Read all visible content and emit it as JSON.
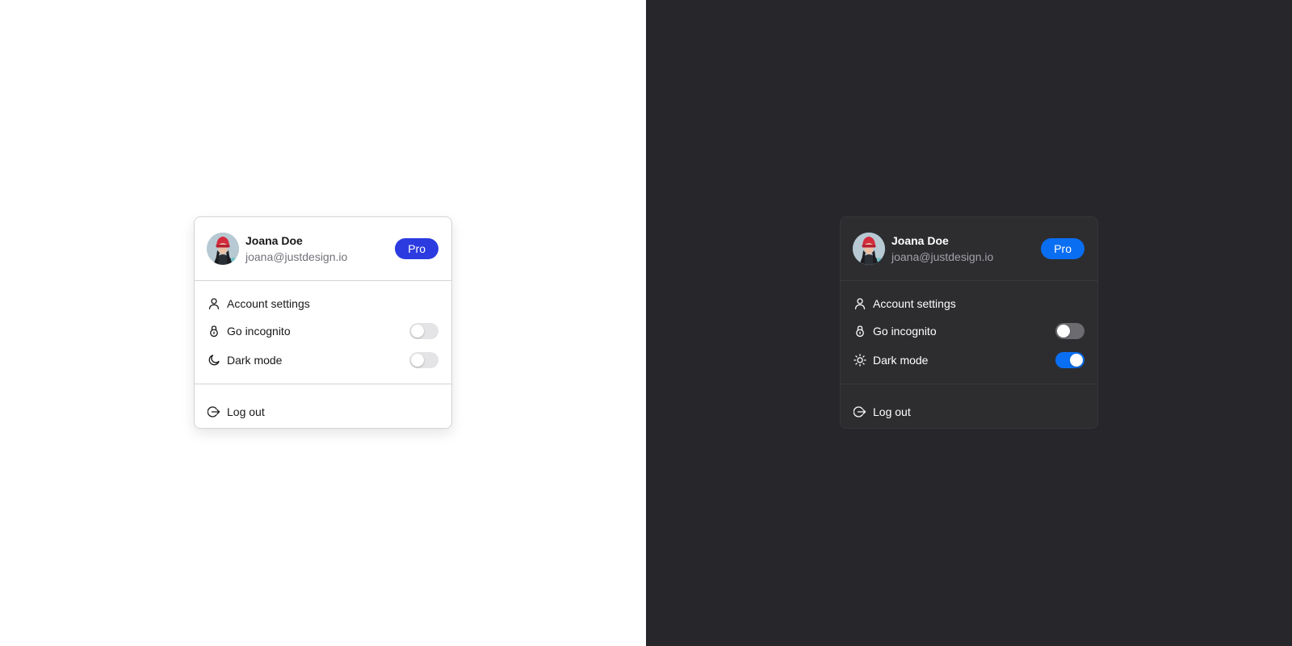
{
  "panels": [
    {
      "theme": "light",
      "user": {
        "name": "Joana Doe",
        "email": "joana@justdesign.io"
      },
      "badge": "Pro",
      "items": {
        "account_settings": "Account settings",
        "go_incognito": "Go incognito",
        "dark_mode": "Dark mode",
        "log_out": "Log out"
      },
      "toggles": {
        "go_incognito": false,
        "dark_mode": false
      },
      "dark_mode_icon": "moon-icon"
    },
    {
      "theme": "dark",
      "user": {
        "name": "Joana Doe",
        "email": "joana@justdesign.io"
      },
      "badge": "Pro",
      "items": {
        "account_settings": "Account settings",
        "go_incognito": "Go incognito",
        "dark_mode": "Dark mode",
        "log_out": "Log out"
      },
      "toggles": {
        "go_incognito": false,
        "dark_mode": true
      },
      "dark_mode_icon": "sun-icon"
    }
  ],
  "colors": {
    "light_background": "#ffffff",
    "dark_background": "#27262b",
    "light_badge": "#2c3be0",
    "dark_badge": "#0a6ef2",
    "toggle_on": "#0a6ef2"
  }
}
